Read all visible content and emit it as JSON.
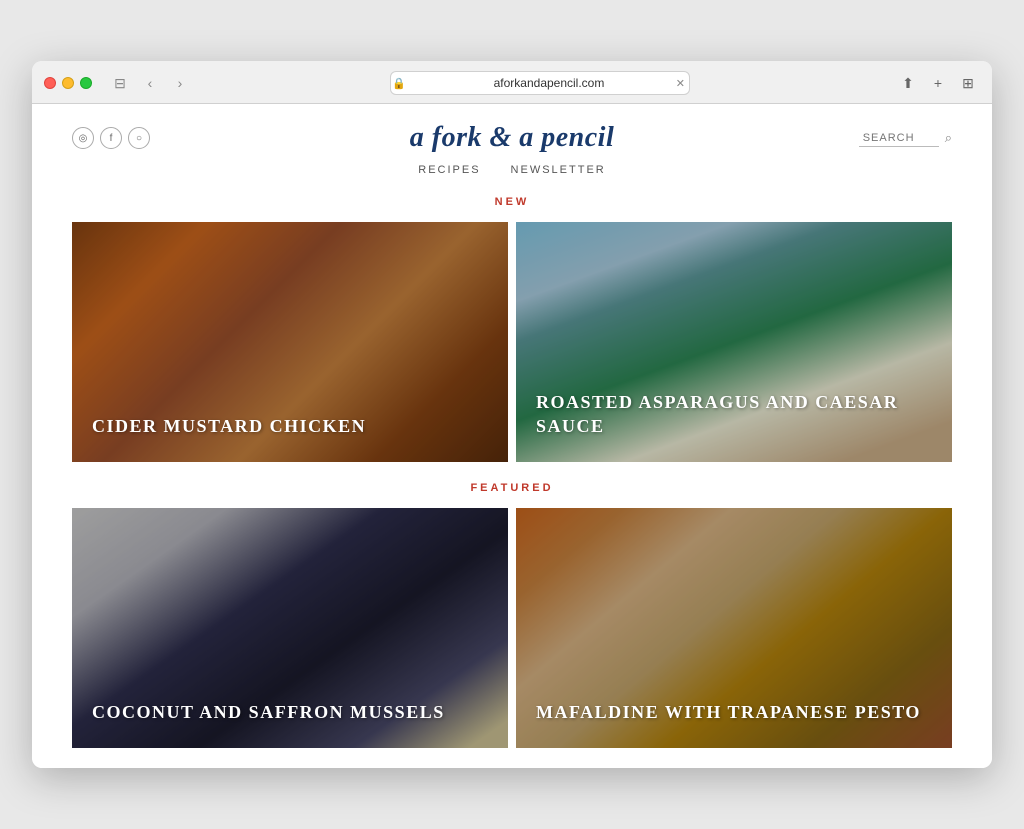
{
  "browser": {
    "url": "aforkandapencil.com",
    "back_label": "‹",
    "forward_label": "›",
    "share_label": "⬆",
    "new_tab_label": "+",
    "grid_label": "⊞"
  },
  "site": {
    "title": "a fork & a pencil",
    "social_icons": [
      {
        "name": "rss",
        "symbol": "◎"
      },
      {
        "name": "facebook",
        "symbol": "f"
      },
      {
        "name": "instagram",
        "symbol": "○"
      }
    ],
    "search_placeholder": "SEARCH",
    "nav": [
      {
        "label": "RECIPES",
        "href": "#"
      },
      {
        "label": "NEWSLETTER",
        "href": "#"
      }
    ]
  },
  "sections": {
    "new": {
      "label": "NEW",
      "recipes": [
        {
          "id": "cider-mustard-chicken",
          "title": "CIDER MUSTARD\nCHICKEN",
          "bg_class": "recipe-chicken"
        },
        {
          "id": "roasted-asparagus",
          "title": "ROASTED\nASPARAGUS AND\nCAESAR SAUCE",
          "bg_class": "recipe-asparagus"
        }
      ]
    },
    "featured": {
      "label": "FEATURED",
      "recipes": [
        {
          "id": "coconut-saffron-mussels",
          "title": "COCONUT AND\nSAFFRON MUSSELS",
          "bg_class": "recipe-mussels"
        },
        {
          "id": "mafaldine-trapanese-pesto",
          "title": "MAFALDINE WITH\nTRAPANESE PESTO",
          "bg_class": "recipe-pasta"
        }
      ]
    }
  }
}
